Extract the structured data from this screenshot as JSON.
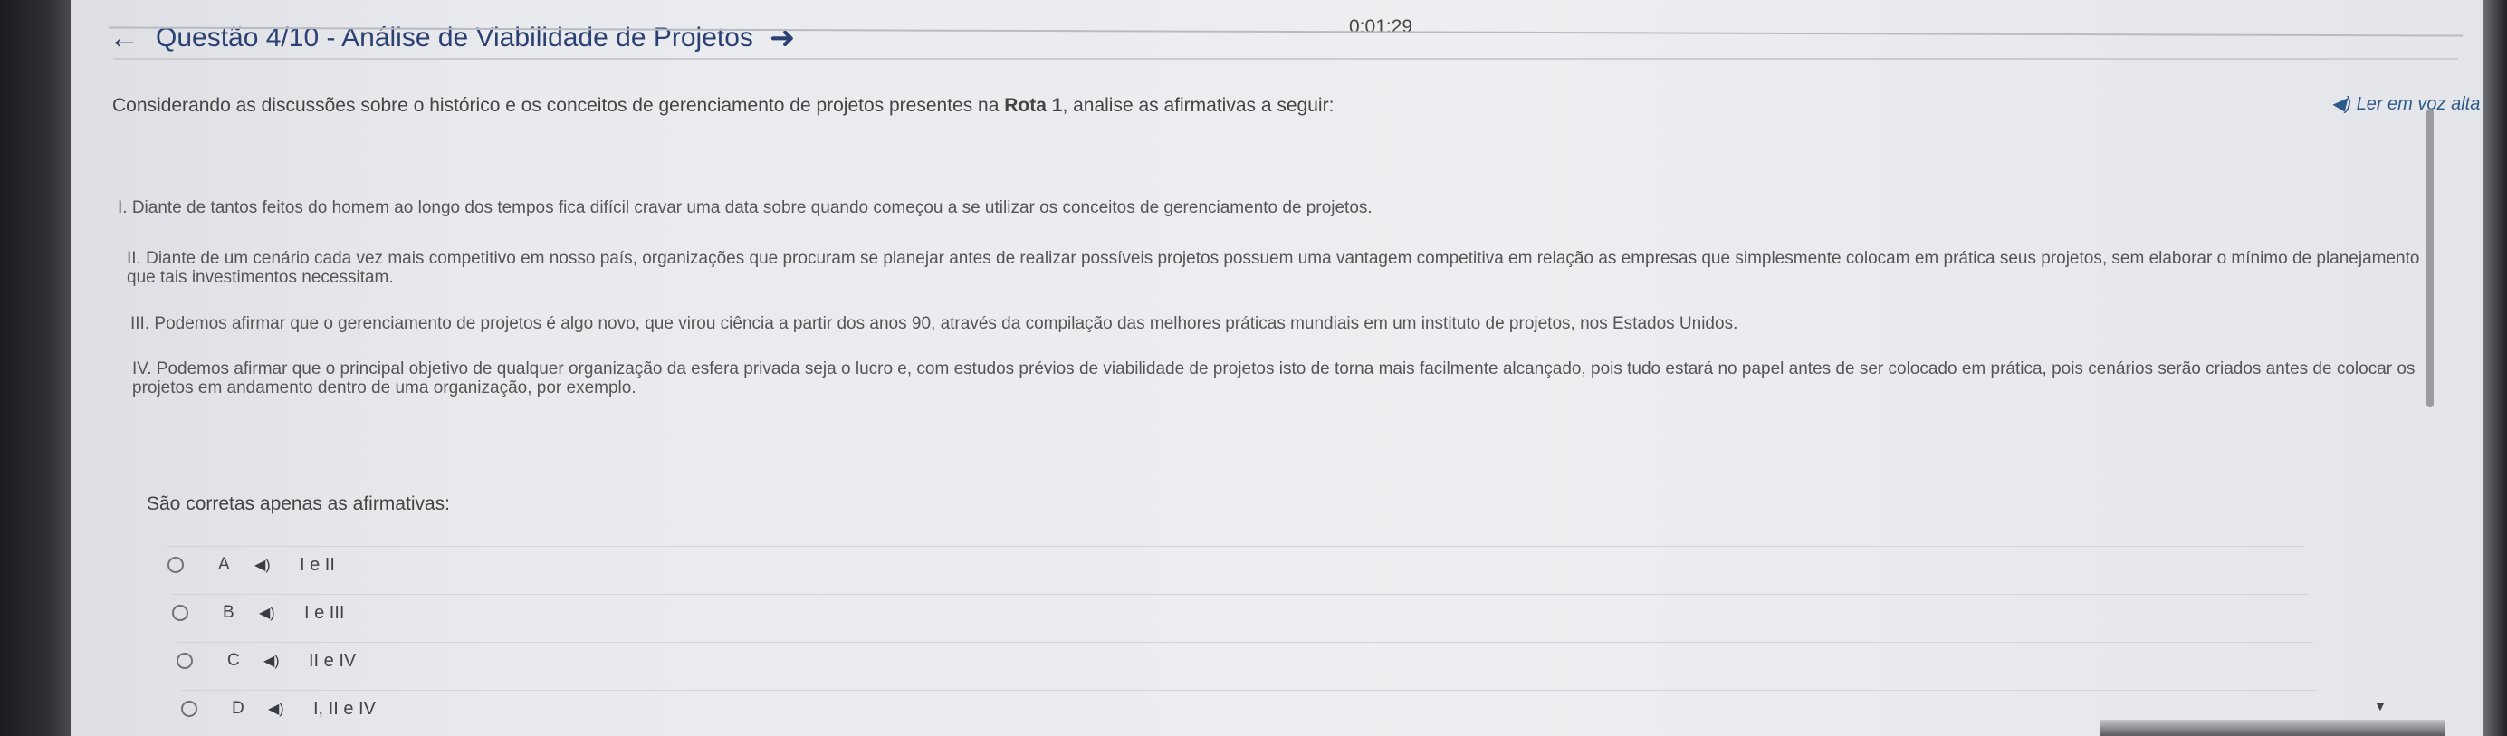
{
  "header": {
    "title": "Questão 4/10 - Análise de Viabilidade de Projetos",
    "timer": "0:01:29"
  },
  "prompt": {
    "before": "Considerando as discussões sobre o histórico e os conceitos de gerenciamento de projetos presentes na ",
    "bold": "Rota 1",
    "after": ", analise as afirmativas a seguir:"
  },
  "read_aloud_label": "◀) Ler em voz alta",
  "statements": [
    {
      "line1": "I. Diante de tantos feitos do homem ao longo dos tempos fica difícil cravar uma data sobre quando começou a se utilizar os conceitos de gerenciamento de projetos.",
      "line2": ""
    },
    {
      "line1": "II. Diante de um cenário cada vez mais competitivo em nosso país, organizações que procuram se planejar antes de realizar possíveis projetos possuem uma vantagem competitiva em relação as empresas que simplesmente colocam em prática seus projetos, sem elaborar o mínimo de planejamento",
      "line2": "que tais investimentos necessitam."
    },
    {
      "line1": "III. Podemos afirmar que o gerenciamento de projetos é algo novo, que virou ciência a partir dos anos 90, através da compilação das melhores práticas mundiais em um instituto de projetos, nos Estados Unidos.",
      "line2": ""
    },
    {
      "line1": "IV. Podemos afirmar que o principal objetivo de qualquer organização da esfera privada seja o lucro e, com estudos prévios de viabilidade de projetos isto de torna mais facilmente alcançado, pois tudo estará no papel antes de ser colocado em prática, pois cenários serão criados antes de colocar os",
      "line2": "projetos em andamento dentro de uma organização, por exemplo."
    }
  ],
  "question": "São corretas apenas as afirmativas:",
  "options": [
    {
      "letter": "A",
      "text": "I e II"
    },
    {
      "letter": "B",
      "text": "I e III"
    },
    {
      "letter": "C",
      "text": "II e IV"
    },
    {
      "letter": "D",
      "text": "I, II e IV"
    }
  ],
  "icons": {
    "back": "arrow-left-icon",
    "forward": "arrow-right-icon",
    "speaker": "speaker-icon",
    "radio": "radio-icon"
  },
  "colors": {
    "title": "#2c4173",
    "tts_link": "#2d5a8a",
    "text": "#444444"
  }
}
